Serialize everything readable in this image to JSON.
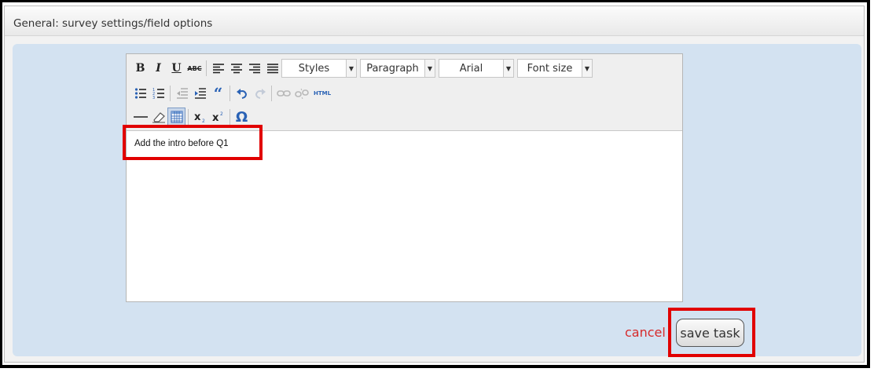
{
  "header": {
    "title": "General: survey settings/field options"
  },
  "toolbar": {
    "row1": {
      "bold": "B",
      "italic": "I",
      "underline": "U",
      "strike": "ABC",
      "styles": "Styles",
      "paragraph": "Paragraph",
      "font": "Arial",
      "font_size": "Font size"
    },
    "row2": {
      "blockquote": "“",
      "html": "HTML"
    },
    "row3": {
      "omega": "Ω"
    }
  },
  "editor": {
    "content": "Add the intro before Q1"
  },
  "actions": {
    "cancel": "cancel",
    "save": "save task"
  },
  "colors": {
    "panel_bg": "#d3e2f1",
    "highlight": "#e10000",
    "cancel_text": "#d62a2a"
  }
}
